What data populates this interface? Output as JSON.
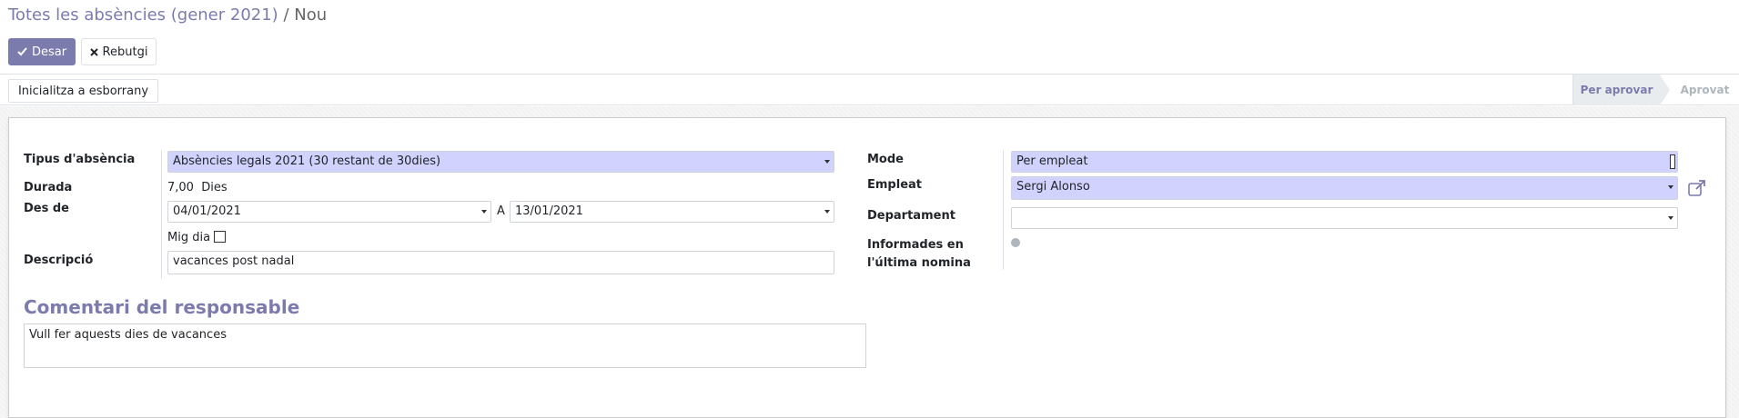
{
  "breadcrumb": {
    "parent": "Totes les absències (gener 2021)",
    "separator": "/",
    "current": "Nou"
  },
  "toolbar": {
    "save_label": "Desar",
    "discard_label": "Rebutgi"
  },
  "statusbar": {
    "draft_button": "Inicialitza a esborrany",
    "stages": [
      "Per aprovar",
      "Aprovat"
    ],
    "active_stage": "Per aprovar"
  },
  "form": {
    "leave_type": {
      "label": "Tipus d'absència",
      "value": "Absències legals 2021 (30 restant de 30dies)"
    },
    "duration": {
      "label": "Durada",
      "value": "7,00",
      "unit": "Dies"
    },
    "date_from": {
      "label": "Des de",
      "from": "04/01/2021",
      "to_label": "A",
      "to": "13/01/2021"
    },
    "half_day": {
      "label": "Mig dia",
      "checked": false
    },
    "description": {
      "label": "Descripció",
      "value": "vacances post nadal"
    },
    "mode": {
      "label": "Mode",
      "value": "Per empleat"
    },
    "employee": {
      "label": "Empleat",
      "value": "Sergi Alonso"
    },
    "department": {
      "label": "Departament",
      "value": ""
    },
    "payslip": {
      "label_line1": "Informades en",
      "label_line2": "l'última nomina"
    }
  },
  "manager_comment": {
    "title": "Comentari del responsable",
    "value": "Vull fer aquests dies de vacances"
  },
  "colors": {
    "accent": "#7c7bad",
    "required_field": "#d2d2ff"
  }
}
